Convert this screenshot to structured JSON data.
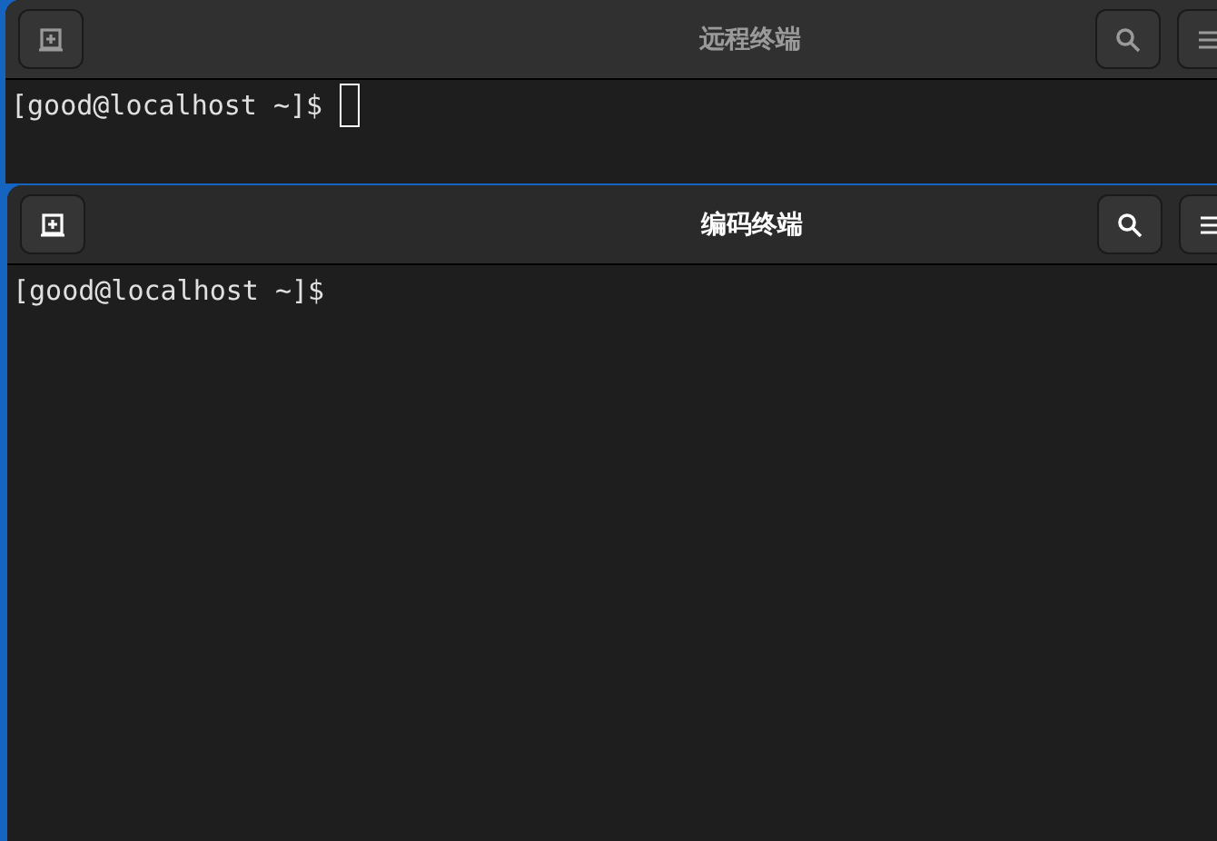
{
  "windows": [
    {
      "title": "远程终端",
      "active": false,
      "prompt": "[good@localhost ~]$",
      "cursor": true
    },
    {
      "title": "编码终端",
      "active": true,
      "prompt": "[good@localhost ~]$",
      "cursor": false
    }
  ]
}
